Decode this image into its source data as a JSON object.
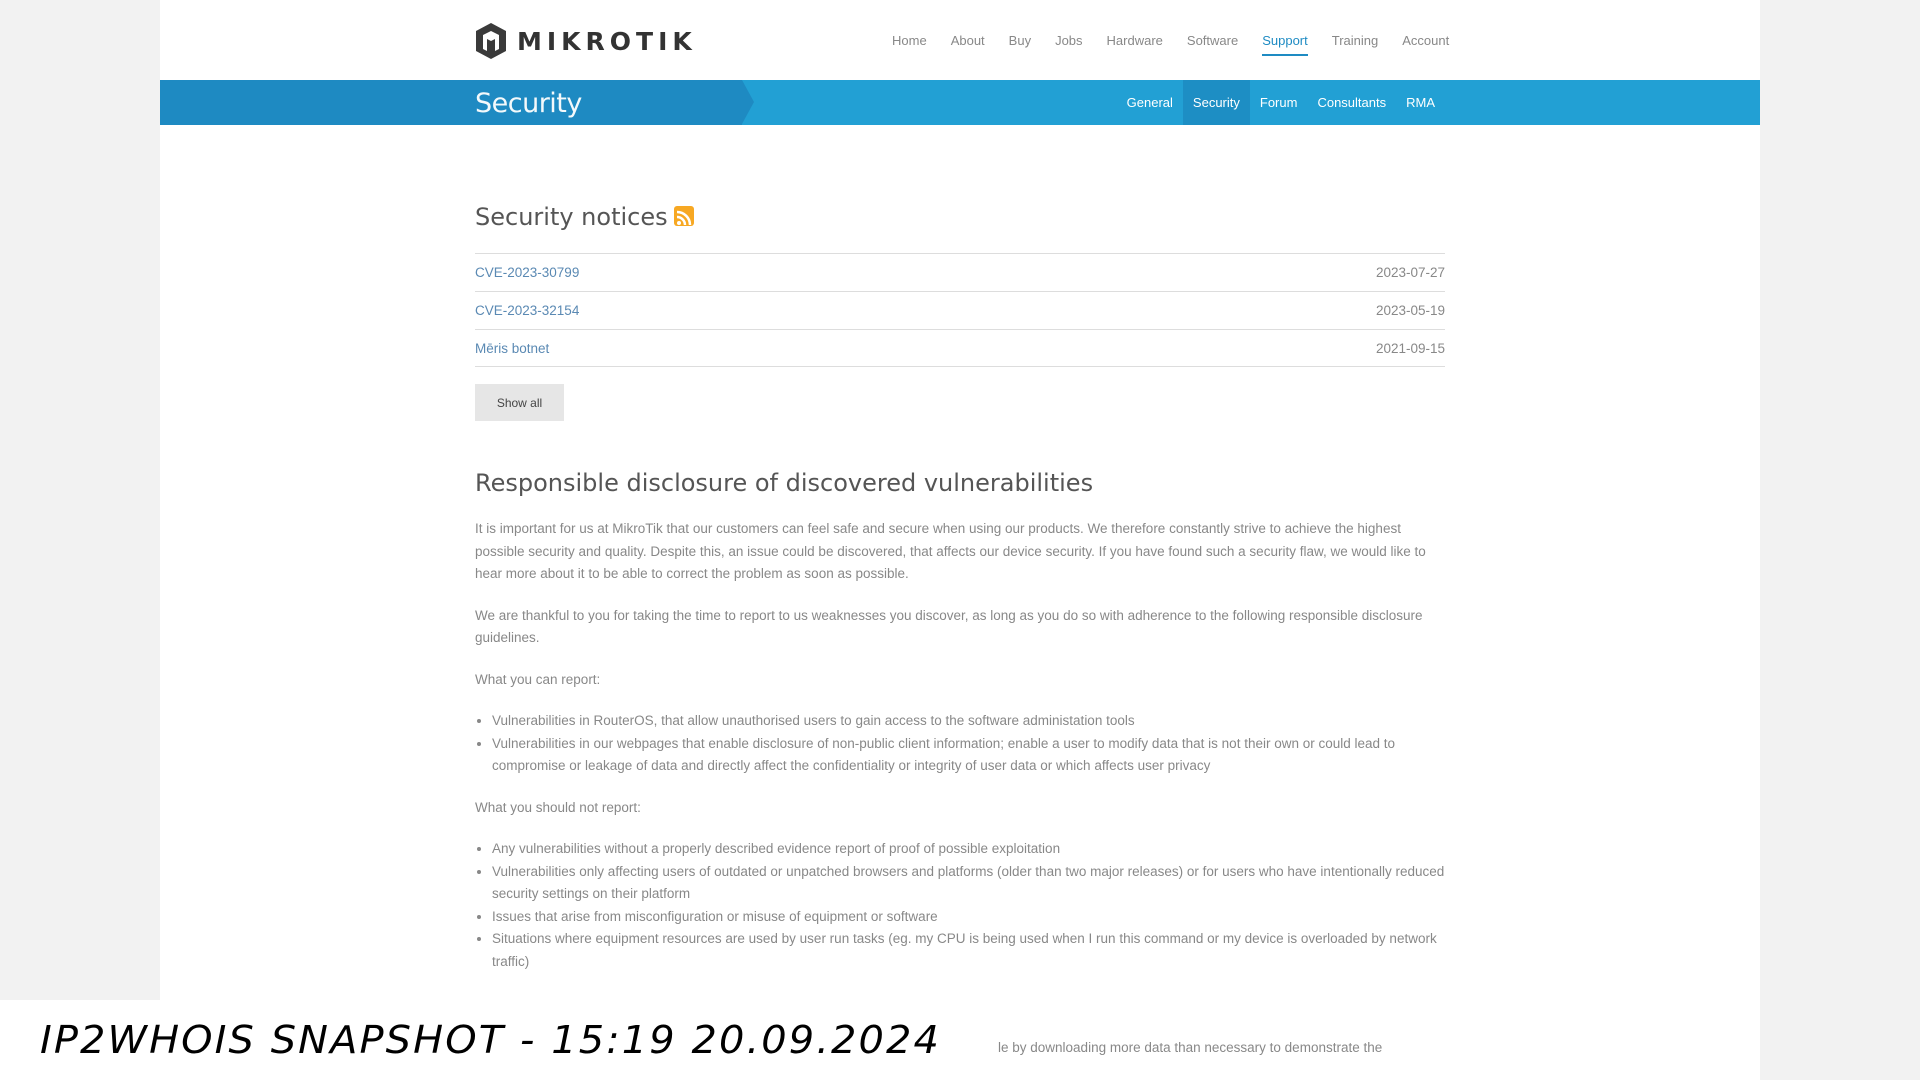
{
  "header": {
    "logo_text": "MIKROTIK",
    "nav": [
      "Home",
      "About",
      "Buy",
      "Jobs",
      "Hardware",
      "Software",
      "Support",
      "Training",
      "Account"
    ],
    "nav_active": "Support"
  },
  "band": {
    "title": "Security",
    "subnav": [
      "General",
      "Security",
      "Forum",
      "Consultants",
      "RMA"
    ],
    "subnav_active": "Security"
  },
  "notices": {
    "title": "Security notices",
    "icon": "rss-icon",
    "items": [
      {
        "title": "CVE-2023-30799",
        "date": "2023-07-27"
      },
      {
        "title": "CVE-2023-32154",
        "date": "2023-05-19"
      },
      {
        "title": "Mēris botnet",
        "date": "2021-09-15"
      }
    ],
    "show_all": "Show all"
  },
  "disclosure": {
    "title": "Responsible disclosure of discovered vulnerabilities",
    "p1": "It is important for us at MikroTik that our customers can feel safe and secure when using our products. We therefore constantly strive to achieve the highest possible security and quality. Despite this, an issue could be discovered, that affects our device security. If you have found such a security flaw, we would like to hear more about it to be able to correct the problem as soon as possible.",
    "p2": "We are thankful to you for taking the time to report to us weaknesses you discover, as long as you do so with adherence to the following responsible disclosure guidelines.",
    "can_title": "What you can report:",
    "can": [
      "Vulnerabilities in RouterOS, that allow unauthorised users to gain access to the software administation tools",
      "Vulnerabilities in our webpages that enable disclosure of non-public client information; enable a user to modify data that is not their own or could lead to compromise or leakage of data and directly affect the confidentiality or integrity of user data or which affects user privacy"
    ],
    "cannot_title": "What you should not report:",
    "cannot": [
      "Any vulnerabilities without a properly described evidence report of proof of possible exploitation",
      "Vulnerabilities only affecting users of outdated or unpatched browsers and platforms (older than two major releases) or for users who have intentionally reduced security settings on their platform",
      "Issues that arise from misconfiguration or misuse of equipment or software",
      "Situations where equipment resources are used by user run tasks (eg. my CPU is being used when I run this command or my device is overloaded by network traffic)"
    ],
    "partial_line": "le by downloading more data than necessary to demonstrate the"
  },
  "watermark": "IP2WHOIS SNAPSHOT - 15:19 20.09.2024",
  "colors": {
    "brand_blue": "#22a0d4",
    "link": "#5a89b3",
    "rss": "#f7a823"
  }
}
